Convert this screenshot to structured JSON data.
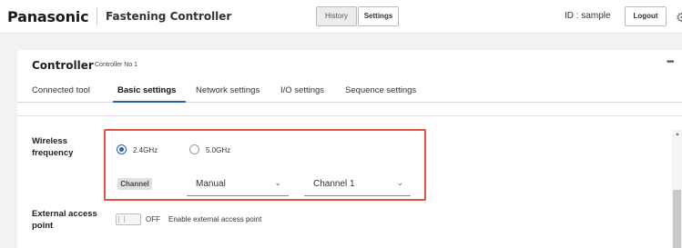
{
  "header": {
    "logo": "Panasonic",
    "app_title": "Fastening Controller",
    "history_label": "History",
    "settings_label": "Settings",
    "user_id": "ID : sample",
    "logout_label": "Logout",
    "settings_icon": "gear-icon"
  },
  "card": {
    "title": "Controller",
    "subtitle": "Controller No 1",
    "more_icon": "ellipsis-icon"
  },
  "tabs": [
    {
      "label": "Connected tool",
      "active": false
    },
    {
      "label": "Basic settings",
      "active": true
    },
    {
      "label": "Network settings",
      "active": false
    },
    {
      "label": "I/O settings",
      "active": false
    },
    {
      "label": "Sequence settings",
      "active": false
    }
  ],
  "wireless": {
    "label_line1": "Wireless",
    "label_line2": "frequency",
    "options": [
      {
        "label": "2.4GHz",
        "selected": true
      },
      {
        "label": "5.0GHz",
        "selected": false
      }
    ],
    "channel_label": "Channel",
    "mode_value": "Manual",
    "channel_value": "Channel 1"
  },
  "external_access": {
    "label_line1": "External access",
    "label_line2": "point",
    "state": "OFF",
    "description": "Enable external access point"
  },
  "colors": {
    "accent": "#2b5fb0",
    "highlight_border": "#e0533f"
  }
}
